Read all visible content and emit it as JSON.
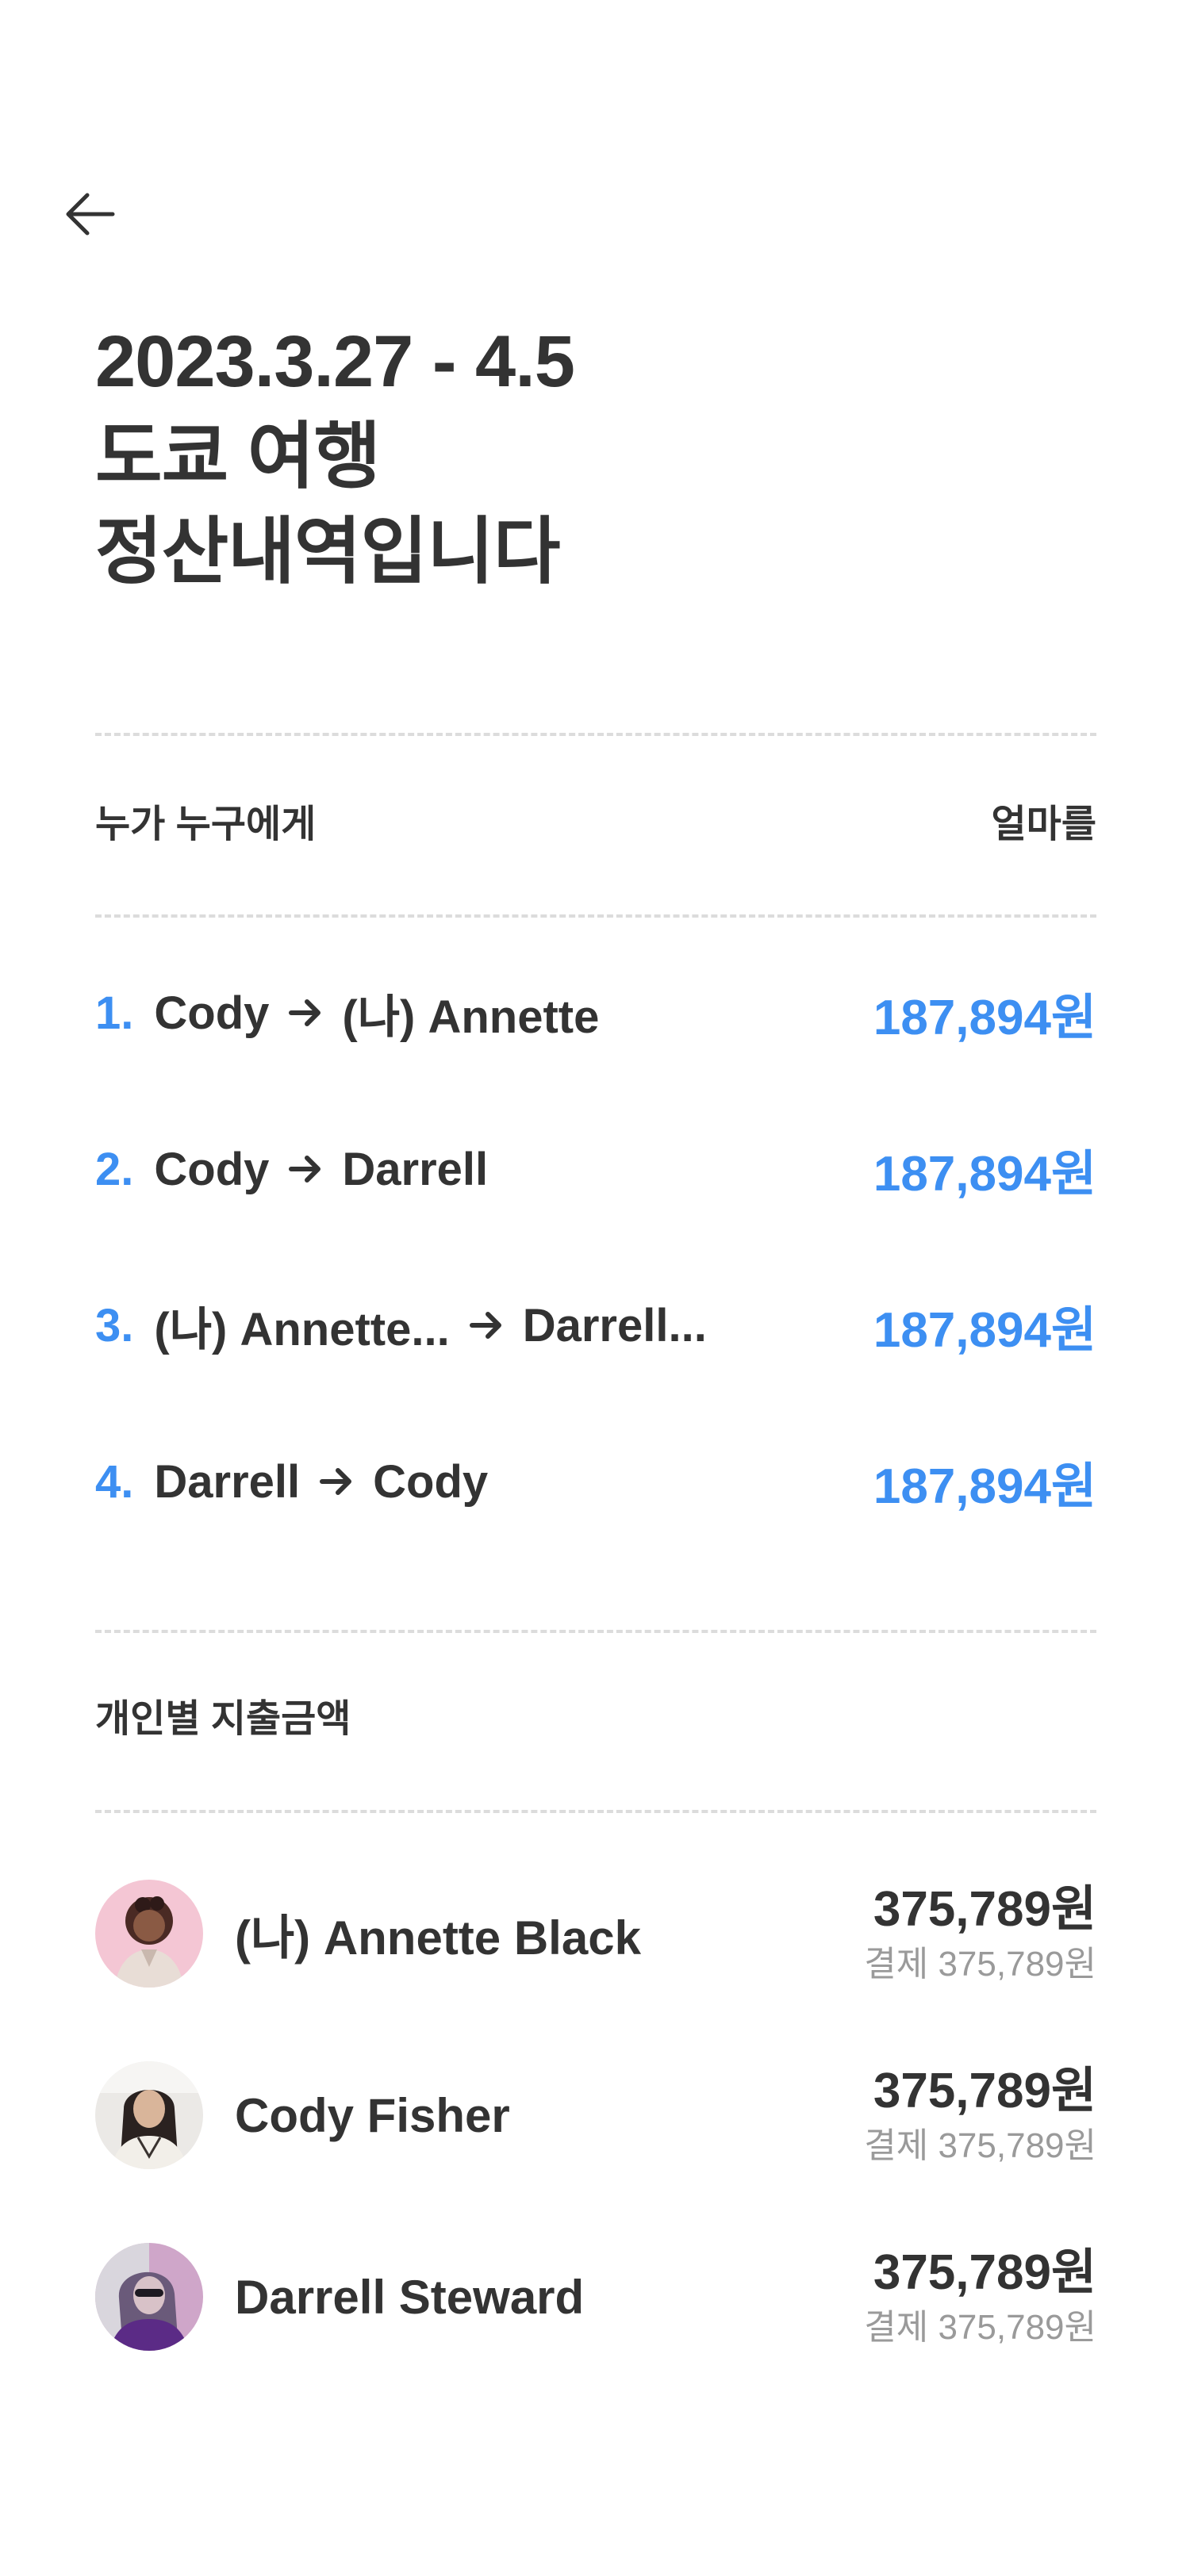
{
  "header": {
    "back_icon": "arrow-left-icon"
  },
  "title": {
    "line1": "2023.3.27 - 4.5",
    "line2": "도쿄 여행",
    "line3": "정산내역입니다"
  },
  "settlement": {
    "header_left": "누가 누구에게",
    "header_right": "얼마를",
    "arrow_icon": "arrow-right-icon",
    "rows": [
      {
        "num": "1.",
        "from": "Cody",
        "to": "(나) Annette",
        "amount": "187,894원"
      },
      {
        "num": "2.",
        "from": "Cody",
        "to": "Darrell",
        "amount": "187,894원"
      },
      {
        "num": "3.",
        "from": "(나) Annette...",
        "to": "Darrell...",
        "amount": "187,894원"
      },
      {
        "num": "4.",
        "from": "Darrell",
        "to": "Cody",
        "amount": "187,894원"
      }
    ]
  },
  "spending": {
    "label": "개인별 지출금액",
    "people": [
      {
        "name": "(나) Annette Black",
        "total": "375,789원",
        "paid": "결제 375,789원",
        "avatar": "avatar-icon"
      },
      {
        "name": "Cody Fisher",
        "total": "375,789원",
        "paid": "결제 375,789원",
        "avatar": "avatar-icon"
      },
      {
        "name": "Darrell Steward",
        "total": "375,789원",
        "paid": "결제 375,789원",
        "avatar": "avatar-icon"
      }
    ]
  },
  "colors": {
    "accent": "#3d8ff2",
    "text": "#333333",
    "muted": "#9a9a9a",
    "divider": "#dcdcdc"
  }
}
